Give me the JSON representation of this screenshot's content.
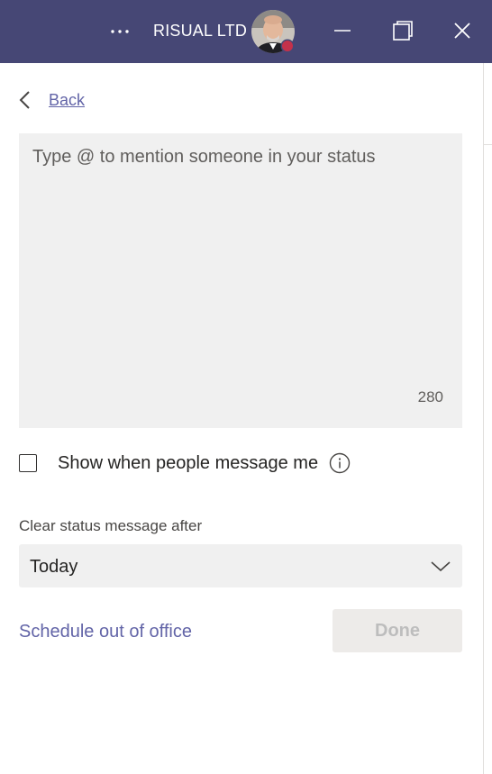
{
  "titlebar": {
    "org_name": "RISUAL LTD",
    "more_icon": "ellipsis-icon",
    "presence_color": "#c4314b",
    "bar_color": "#464775"
  },
  "panel": {
    "back_label": "Back",
    "status_placeholder": "Type @ to mention someone in your status",
    "char_counter": "280",
    "show_when_label": "Show when people message me",
    "show_when_checked": false,
    "clear_after_label": "Clear status message after",
    "clear_after_value": "Today",
    "schedule_link": "Schedule out of office",
    "done_label": "Done",
    "accent_color": "#6264a7"
  }
}
